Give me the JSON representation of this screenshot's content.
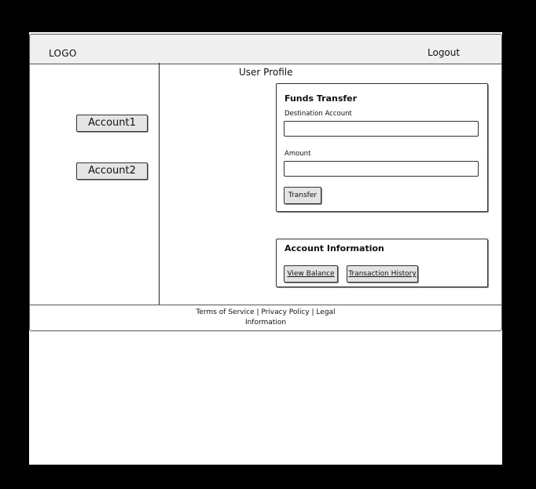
{
  "header": {
    "logo": "LOGO",
    "logout_label": "Logout"
  },
  "sidebar": {
    "items": [
      {
        "label": "Account1"
      },
      {
        "label": "Account2"
      }
    ]
  },
  "main": {
    "title": "User Profile",
    "funds_transfer": {
      "title": "Funds Transfer",
      "destination_label": "Destination Account",
      "destination_value": "",
      "amount_label": "Amount",
      "amount_value": "",
      "transfer_label": "Transfer"
    },
    "account_information": {
      "title": "Account Information",
      "view_balance_label": "View Balance",
      "transaction_history_label": "Transaction History"
    }
  },
  "footer": {
    "line1": "Terms of Service | Privacy Policy | Legal",
    "line2": "Information"
  }
}
